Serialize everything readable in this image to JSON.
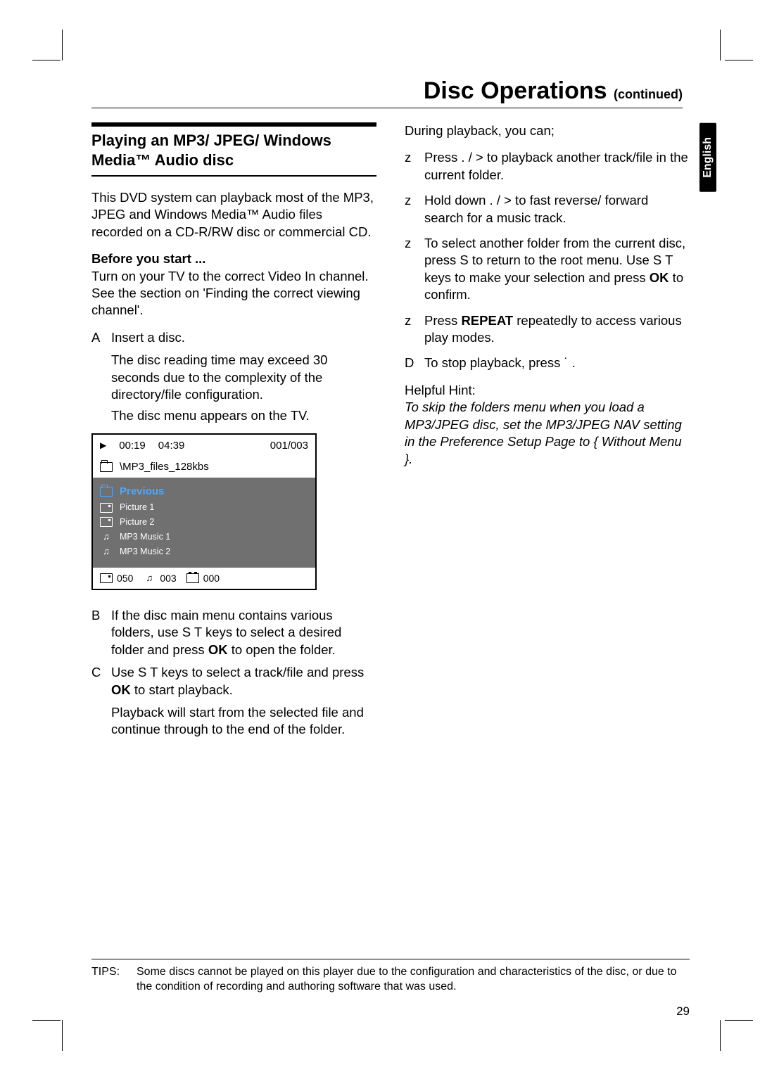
{
  "header": {
    "title_main": "Disc Operations",
    "title_sub": "(continued)"
  },
  "language_tab": "English",
  "left": {
    "section_heading": "Playing an MP3/ JPEG/ Windows Media™ Audio disc",
    "intro": "This DVD system can playback most of the MP3, JPEG and Windows Media™ Audio files recorded on a CD-R/RW disc or commercial CD.",
    "before_label": "Before you start ...",
    "before_body": "Turn on your TV to the correct Video In channel.  See the section on 'Finding the correct viewing channel'.",
    "step_a_marker": "A",
    "step_a": "Insert a disc.",
    "step_a_note1": "The disc reading time may exceed 30 seconds due to the complexity of the directory/file configuration.",
    "step_a_note2": "The disc menu appears on the TV.",
    "step_b_marker": "B",
    "step_b_pre": "If the disc main menu contains various folders, use  S T  keys to select a desired folder and press ",
    "step_b_bold": "OK",
    "step_b_post": " to open the folder.",
    "step_c_marker": "C",
    "step_c_pre": "Use  S T  keys to select a track/file and press ",
    "step_c_bold": "OK",
    "step_c_post": " to start playback.",
    "step_c_note": "Playback will start from the selected file and continue through to the end of the folder."
  },
  "disc_menu": {
    "play_icon": "▶",
    "time_current": "00:19",
    "time_total": "04:39",
    "track_index": "001/003",
    "path": "\\MP3_files_128kbs",
    "previous": "Previous",
    "items": [
      "Picture 1",
      "Picture 2",
      "MP3 Music 1",
      "MP3 Music 2"
    ],
    "footer_count1": "050",
    "footer_count2": "003",
    "footer_count3": "000"
  },
  "right": {
    "during": "During playback, you can;",
    "b1_marker": "z",
    "b1": "Press  .      /  >      to playback another track/file in the current folder.",
    "b2_marker": "z",
    "b2": "Hold down  .      /  >      to fast reverse/ forward search for a music track.",
    "b3_marker": "z",
    "b3_pre": "To select another folder from the current disc, press  S  to return to the root menu.  Use  S T  keys to make your selection and press ",
    "b3_bold": "OK",
    "b3_post": " to confirm.",
    "b4_marker": "z",
    "b4_pre": "Press ",
    "b4_bold": "REPEAT",
    "b4_post": " repeatedly to access various play modes.",
    "step_d_marker": "D",
    "step_d": "To stop playback, press  ˙  .",
    "hint_head": "Helpful Hint:",
    "hint_body": "To skip the folders menu when you load a MP3/JPEG disc, set the MP3/JPEG NAV setting in the Preference Setup Page to { Without Menu }."
  },
  "tips": {
    "label": "TIPS:",
    "text": "Some discs cannot be played on this player due to the configuration and characteristics of the disc, or due to the condition of recording and authoring software that was used."
  },
  "page_number": "29"
}
